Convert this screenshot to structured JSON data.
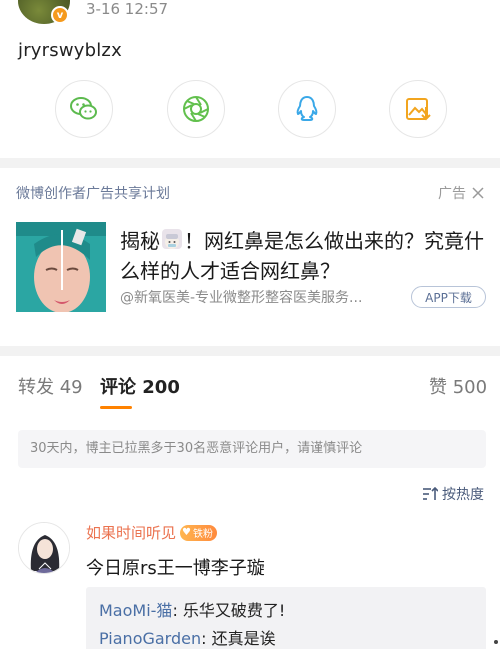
{
  "post": {
    "timestamp": "3-16 12:57",
    "verified_badge": "v",
    "text": "jryrswyblzx",
    "share_buttons": [
      {
        "icon": "wechat-icon",
        "color": "#5cba4e"
      },
      {
        "icon": "moments-icon",
        "color": "#62c04d"
      },
      {
        "icon": "qq-icon",
        "color": "#3aa8e8"
      },
      {
        "icon": "save-image-icon",
        "color": "#f2a51f"
      }
    ]
  },
  "ad": {
    "program_label": "微博创作者广告共享计划",
    "ad_tag": "广告",
    "close_icon": "close-icon",
    "title_part1": "揭秘",
    "title_part2": "！网红鼻是怎么做出来的？究竟什么样的人才适合网红鼻？",
    "source": "@新氧医美-专业微整形整容医美服务...",
    "app_button": "APP下载"
  },
  "tabs": {
    "reposts": "转发 49",
    "comments": "评论 200",
    "likes": "赞 500"
  },
  "notice": "30天内，博主已拉黑多于30名恶意评论用户，请谨慎评论",
  "sort": {
    "icon": "sort-icon",
    "label": "按热度"
  },
  "comment": {
    "username": "如果时间听见",
    "fan_badge": "铁粉",
    "text": "今日原rs王一博李子璇",
    "replies": [
      {
        "user": "MaoMi-猫",
        "sep": ": ",
        "text": "乐华又破费了!"
      },
      {
        "user": "PianoGarden",
        "sep": ": ",
        "text": "还真是诶"
      }
    ]
  },
  "colors": {
    "accent": "#ff8200",
    "username": "#eb7350",
    "link": "#4a6fa5"
  }
}
